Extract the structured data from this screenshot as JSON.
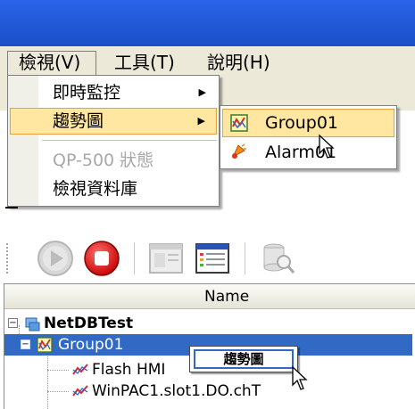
{
  "menubar": {
    "view": "檢視(V)",
    "tools": "工具(T)",
    "help": "說明(H)"
  },
  "view_menu": {
    "items": [
      {
        "label": "即時監控",
        "has_submenu": true,
        "state": "normal"
      },
      {
        "label": "趨勢圖",
        "has_submenu": true,
        "state": "highlighted"
      },
      {
        "label": "QP-500 狀態",
        "has_submenu": false,
        "state": "disabled"
      },
      {
        "label": "檢視資料庫",
        "has_submenu": false,
        "state": "normal"
      }
    ],
    "arrow_glyph": "▶"
  },
  "trend_submenu": {
    "items": [
      {
        "label": "Group01",
        "icon": "trend-chart-icon",
        "state": "highlighted"
      },
      {
        "label": "Alarm01",
        "icon": "alarm-bell-icon",
        "state": "normal"
      }
    ]
  },
  "toolbar": {
    "buttons": [
      {
        "name": "play-button",
        "icon": "play-icon",
        "enabled": false
      },
      {
        "name": "stop-button",
        "icon": "stop-icon",
        "enabled": true
      },
      {
        "name": "panel-button",
        "icon": "window-icon",
        "enabled": false
      },
      {
        "name": "list-button",
        "icon": "list-window-icon",
        "enabled": true
      },
      {
        "name": "database-search-button",
        "icon": "database-search-icon",
        "enabled": false
      }
    ]
  },
  "tree": {
    "column_header": "Name",
    "root": {
      "label": "NetDBTest",
      "expander": "⊟"
    },
    "group": {
      "label": "Group01",
      "expander": "⊟",
      "selected": true
    },
    "children": [
      {
        "label": "Flash HMI"
      },
      {
        "label": "WinPAC1.slot1.DO.chT"
      }
    ]
  },
  "context_menu": {
    "item": "趨勢圖"
  },
  "colors": {
    "highlight_fill": "#ffe7a2",
    "highlight_border": "#e8a13c",
    "selection": "#316ac5",
    "titlebar": "#2a64e8",
    "menubar": "#ece9d8"
  }
}
